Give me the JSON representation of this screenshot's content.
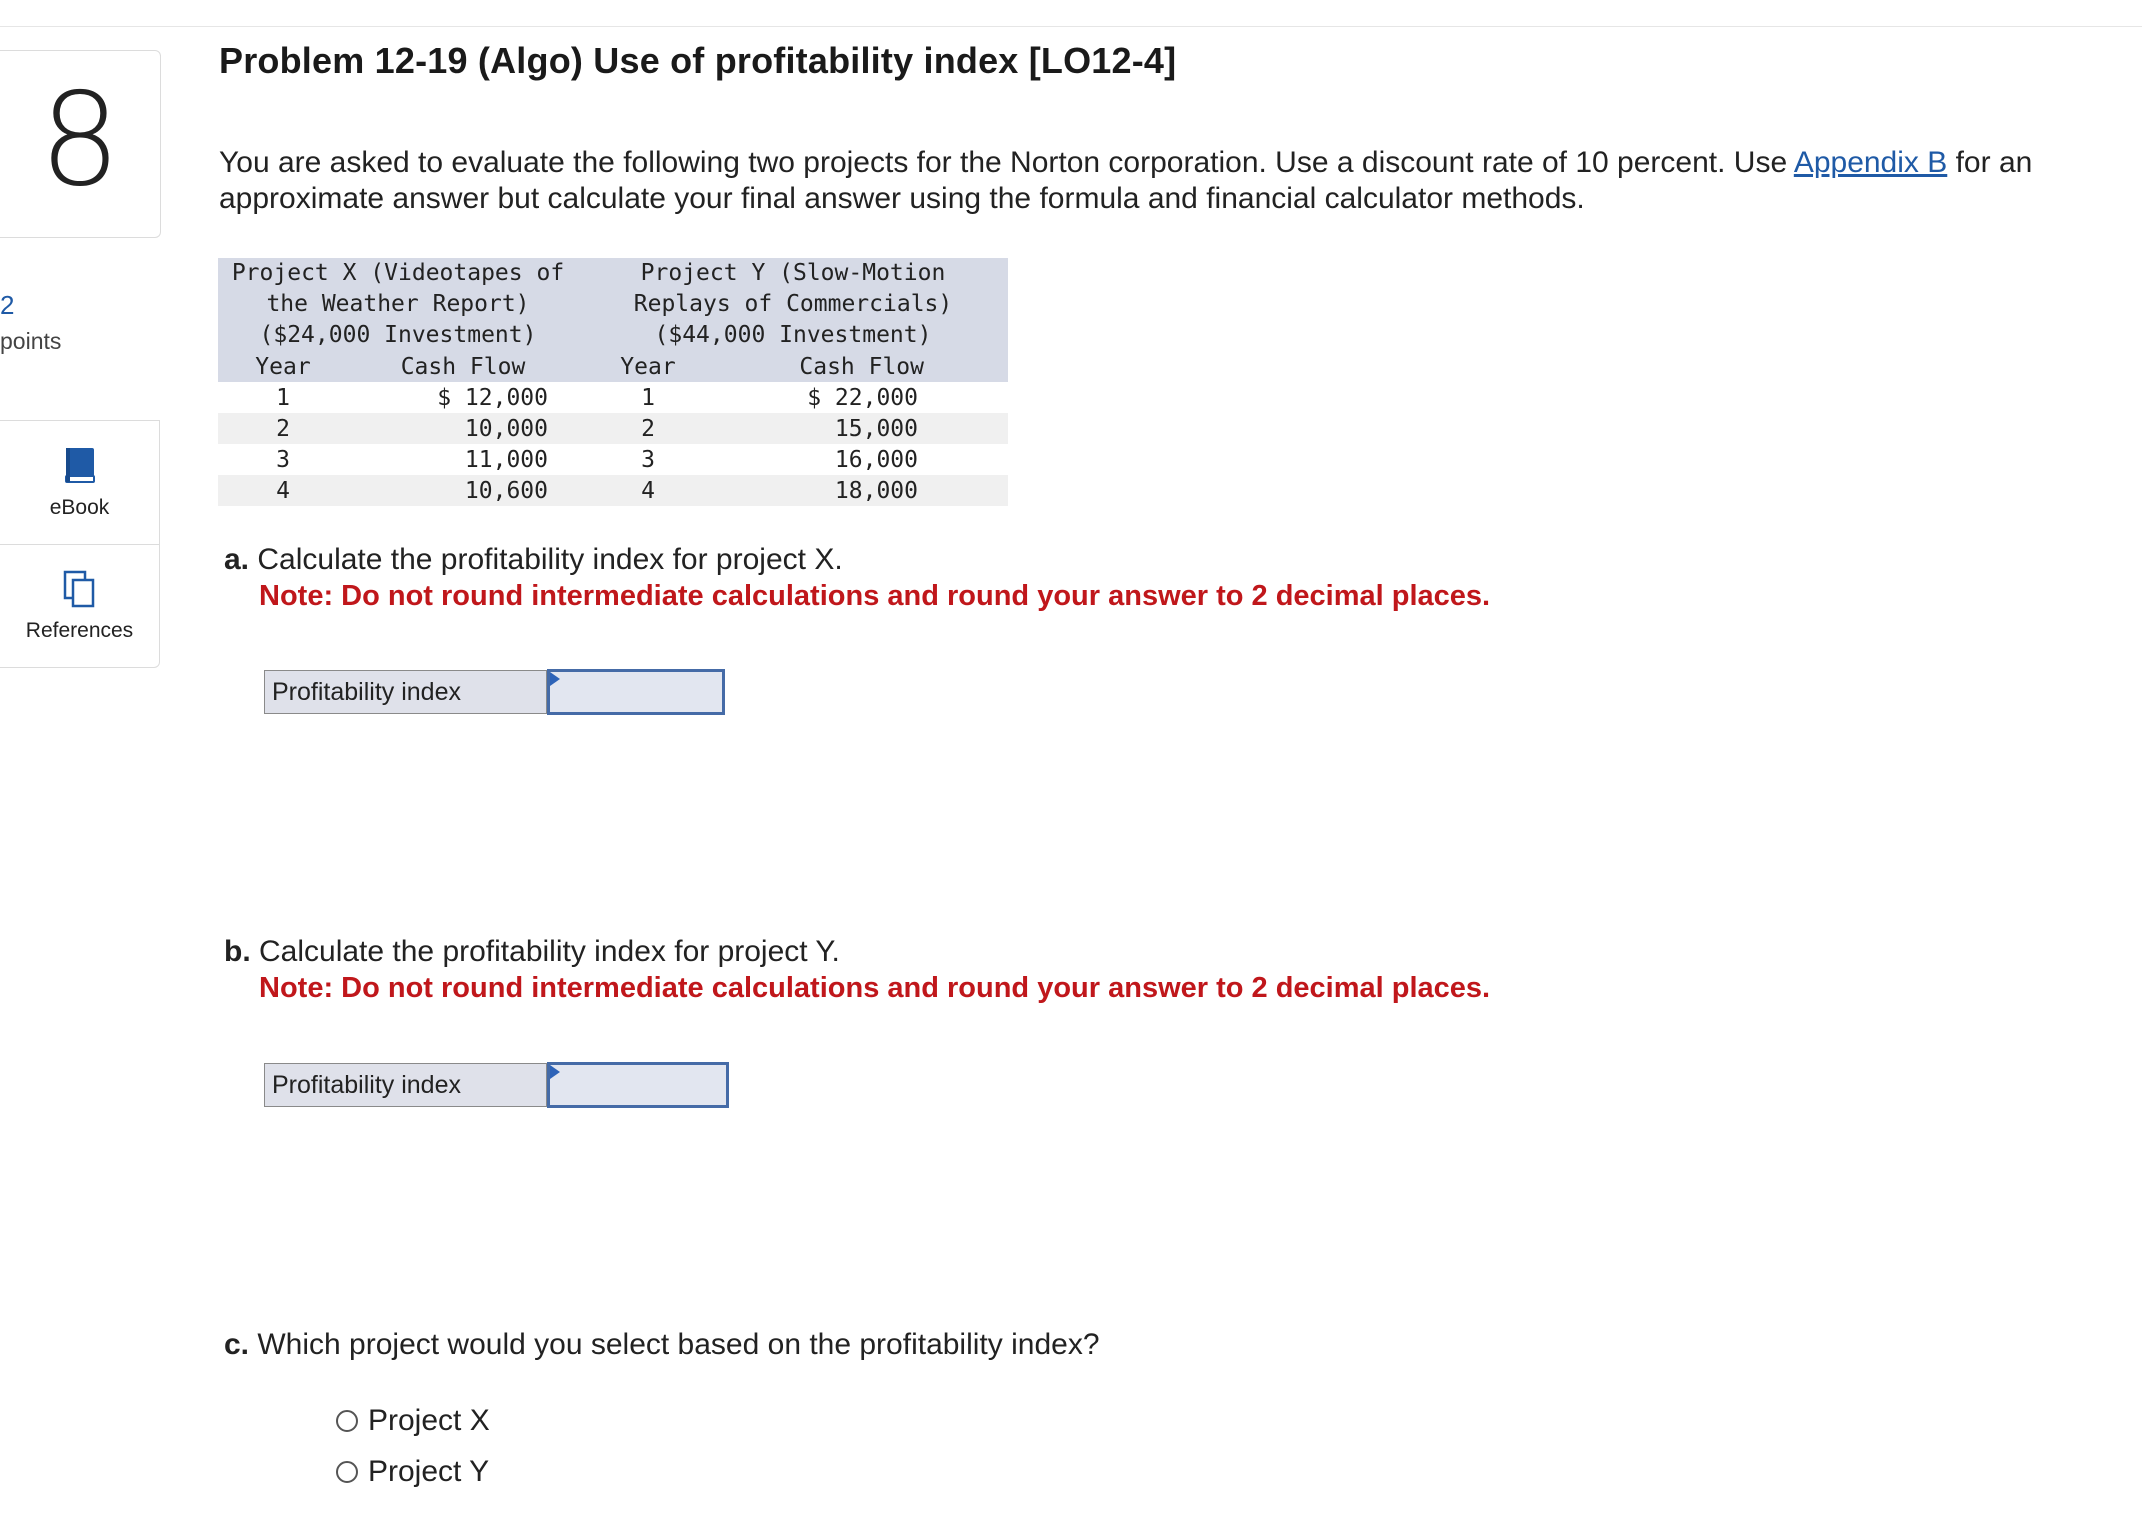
{
  "question": {
    "number": "8",
    "points_value": "2",
    "points_label": "points",
    "title": "Problem 12-19 (Algo) Use of profitability index [LO12-4]",
    "intro_before_link": "You are asked to evaluate the following two projects for the Norton corporation. Use a discount rate of 10 percent. Use ",
    "appendix_link": "Appendix B",
    "intro_after_link": " for an approximate answer but calculate your final answer using the formula and financial calculator methods."
  },
  "tools": {
    "ebook_label": "eBook",
    "references_label": "References",
    "ebook_icon": "book-icon",
    "references_icon": "copy-icon"
  },
  "table": {
    "project_x": {
      "header_lines": [
        "Project X (Videotapes of",
        "the Weather Report)",
        "($24,000 Investment)"
      ],
      "year_header": "Year",
      "cf_header": "Cash Flow"
    },
    "project_y": {
      "header_lines": [
        "Project Y (Slow-Motion",
        "Replays of Commercials)",
        "($44,000 Investment)"
      ],
      "year_header": "Year",
      "cf_header": "Cash Flow"
    },
    "rows": [
      {
        "x_year": "1",
        "x_cf": "$ 12,000",
        "y_year": "1",
        "y_cf": "$ 22,000"
      },
      {
        "x_year": "2",
        "x_cf": "10,000",
        "y_year": "2",
        "y_cf": "15,000"
      },
      {
        "x_year": "3",
        "x_cf": "11,000",
        "y_year": "3",
        "y_cf": "16,000"
      },
      {
        "x_year": "4",
        "x_cf": "10,600",
        "y_year": "4",
        "y_cf": "18,000"
      }
    ]
  },
  "parts": {
    "a": {
      "letter": "a.",
      "question": " Calculate the profitability index for project X.",
      "note": "Note: Do not round intermediate calculations and round your answer to 2 decimal places.",
      "answer_label": "Profitability index",
      "answer_value": ""
    },
    "b": {
      "letter": "b.",
      "question": " Calculate the profitability index for project Y.",
      "note": "Note: Do not round intermediate calculations and round your answer to 2 decimal places.",
      "answer_label": "Profitability index",
      "answer_value": ""
    },
    "c": {
      "letter": "c.",
      "question": " Which project would you select based on the profitability index?",
      "options": [
        "Project X",
        "Project Y"
      ]
    }
  }
}
